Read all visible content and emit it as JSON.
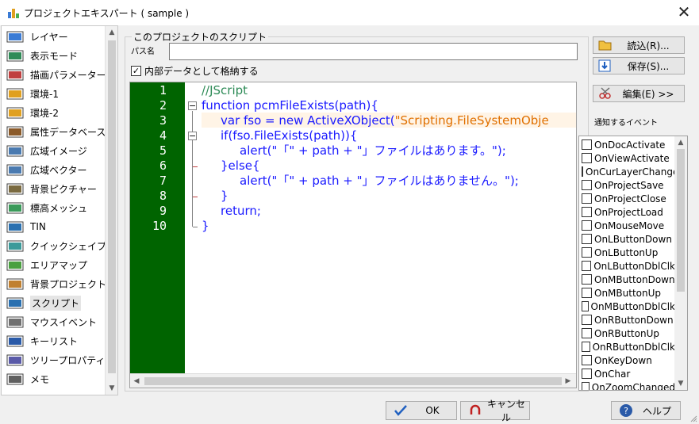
{
  "window": {
    "title": "プロジェクトエキスパート ( sample )"
  },
  "nav": {
    "items": [
      {
        "label": "レイヤー",
        "icon": "layer-icon"
      },
      {
        "label": "表示モード",
        "icon": "display-mode-icon"
      },
      {
        "label": "描画パラメーター",
        "icon": "draw-param-icon"
      },
      {
        "label": "環境-1",
        "icon": "environment-icon"
      },
      {
        "label": "環境-2",
        "icon": "environment-icon"
      },
      {
        "label": "属性データベース",
        "icon": "database-icon"
      },
      {
        "label": "広域イメージ",
        "icon": "wide-image-icon"
      },
      {
        "label": "広域ベクター",
        "icon": "wide-vector-icon"
      },
      {
        "label": "背景ピクチャー",
        "icon": "background-picture-icon"
      },
      {
        "label": "標高メッシュ",
        "icon": "elevation-mesh-icon"
      },
      {
        "label": "TIN",
        "icon": "tin-icon"
      },
      {
        "label": "クイックシェイプ",
        "icon": "quick-shape-icon"
      },
      {
        "label": "エリアマップ",
        "icon": "area-map-icon"
      },
      {
        "label": "背景プロジェクト",
        "icon": "background-project-icon"
      },
      {
        "label": "スクリプト",
        "icon": "script-icon",
        "selected": true
      },
      {
        "label": "マウスイベント",
        "icon": "mouse-icon"
      },
      {
        "label": "キーリスト",
        "icon": "key-list-icon"
      },
      {
        "label": "ツリープロパティ",
        "icon": "tree-property-icon"
      },
      {
        "label": "メモ",
        "icon": "memo-icon"
      }
    ]
  },
  "script": {
    "group_title": "このプロジェクトのスクリプト",
    "path_label": "パス名",
    "path_value": "",
    "store_internal_label": "内部データとして格納する",
    "store_internal_checked": true,
    "line_numbers": [
      "1",
      "2",
      "3",
      "4",
      "5",
      "6",
      "7",
      "8",
      "9",
      "10"
    ],
    "code": [
      "//JScript",
      "function pcmFileExists(path){",
      "var fso = new ActiveXObject(",
      "if(fso.FileExists(path)){",
      "alert(\"「\" + path + \"」ファイルはあります。\");",
      "}else{",
      "alert(\"「\" + path + \"」ファイルはありません。\");",
      "}",
      "return;",
      "}"
    ],
    "code_line3_string": "\"Scripting.FileSystemObje"
  },
  "buttons": {
    "load": "読込(R)...",
    "save": "保存(S)...",
    "edit": "編集(E) >>",
    "ok": "OK",
    "cancel": "キャンセル",
    "help": "ヘルプ"
  },
  "events": {
    "label": "通知するイベント",
    "items": [
      "OnDocActivate",
      "OnViewActivate",
      "OnCurLayerChanged",
      "OnProjectSave",
      "OnProjectClose",
      "OnProjectLoad",
      "OnMouseMove",
      "OnLButtonDown",
      "OnLButtonUp",
      "OnLButtonDblClk",
      "OnMButtonDown",
      "OnMButtonUp",
      "OnMButtonDblClk",
      "OnRButtonDown",
      "OnRButtonUp",
      "OnRButtonDblClk",
      "OnKeyDown",
      "OnChar",
      "OnZoomChanged"
    ]
  },
  "colors": {
    "gutter": "#006400",
    "keyword": "#1a1aff",
    "comment": "#2e8b57",
    "string": "#e07000"
  }
}
